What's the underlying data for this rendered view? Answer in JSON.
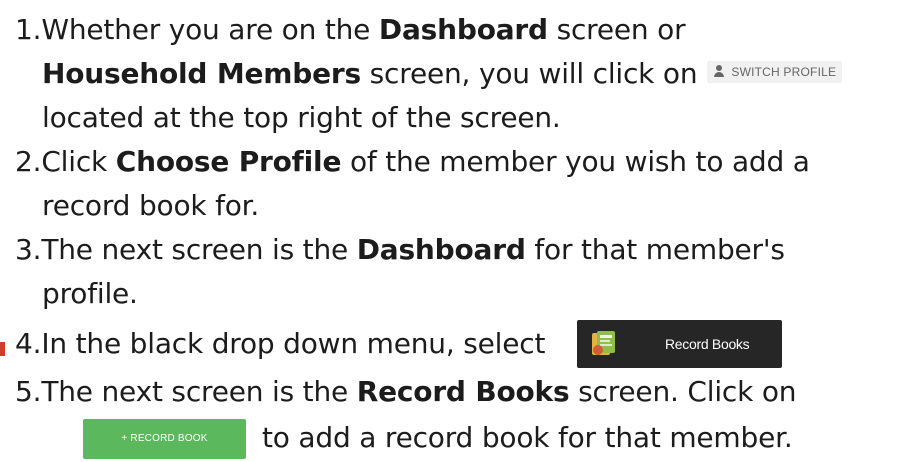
{
  "instructions": {
    "step1": {
      "number": "1.",
      "text_a": "Whether you are on the ",
      "bold_a": "Dashboard",
      "text_b": " screen or",
      "bold_b": "Household Members",
      "text_c": " screen, you will click on",
      "text_d": "located at the top right of the screen."
    },
    "step2": {
      "number": "2.",
      "text_a": "Click ",
      "bold_a": "Choose Profile",
      "text_b": " of the member you wish to add a",
      "text_c": "record book for."
    },
    "step3": {
      "number": "3.",
      "text_a": "The next screen is the ",
      "bold_a": "Dashboard",
      "text_b": " for that member's",
      "text_c": "profile."
    },
    "step4": {
      "number": "4.",
      "text_a": "In the black drop down menu, select"
    },
    "step5": {
      "number": "5.",
      "text_a": "The next screen is the ",
      "bold_a": "Record Books",
      "text_b": " screen. Click on",
      "text_c": "to add a record book for that member."
    }
  },
  "buttons": {
    "switch_profile": {
      "label": "SWITCH PROFILE",
      "icon": "person-icon"
    },
    "record_books": {
      "label": "Record Books",
      "icon": "record-book-icon"
    },
    "add_record_book": {
      "label": "+ RECORD BOOK",
      "color": "#5cb85c"
    }
  },
  "colors": {
    "text": "#1c1c1c",
    "menu_background": "#262626",
    "switch_profile_background": "#f1f1f1",
    "add_button_green": "#5cb85c",
    "red_marker": "#d33c2a"
  }
}
